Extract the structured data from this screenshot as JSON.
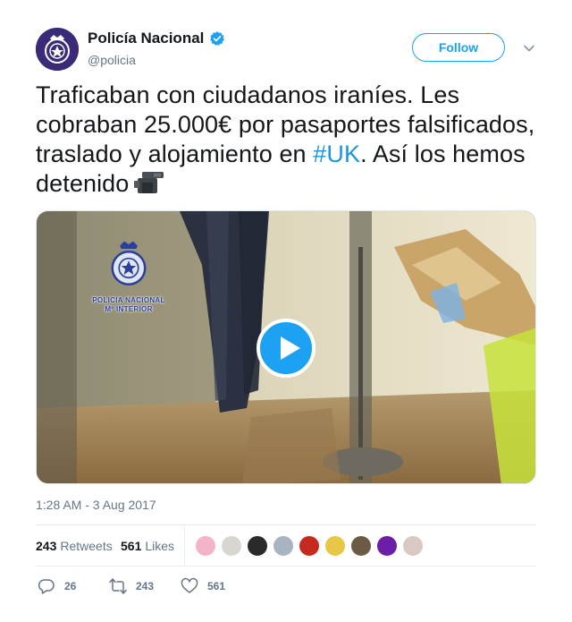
{
  "account": {
    "name": "Policía Nacional",
    "handle": "@policia",
    "verified": true,
    "follow_label": "Follow"
  },
  "tweet": {
    "text_before": "Traficaban con ciudadanos iraníes. Les cobraban 25.000€ por pasaportes falsificados, traslado y alojamiento en ",
    "hashtag": "#UK",
    "text_after": ". Así los hemos detenido",
    "emoji_icon": "video-camera-icon"
  },
  "media": {
    "type": "video",
    "watermark_line1": "POLICIA NACIONAL",
    "watermark_line2": "Mº INTERIOR"
  },
  "timestamp": "1:28 AM - 3 Aug 2017",
  "stats": {
    "retweets_count": "243",
    "retweets_label": "Retweets",
    "likes_count": "561",
    "likes_label": "Likes"
  },
  "likers": [
    {
      "color": "#f3b3c8"
    },
    {
      "color": "#d8d6cf"
    },
    {
      "color": "#2a2a2a"
    },
    {
      "color": "#aab4c0"
    },
    {
      "color": "#c62a1e"
    },
    {
      "color": "#e8c646"
    },
    {
      "color": "#6b5a45"
    },
    {
      "color": "#6a1fa6"
    },
    {
      "color": "#d9c9c2"
    }
  ],
  "actions": {
    "reply_count": "26",
    "retweet_count": "243",
    "like_count": "561"
  },
  "colors": {
    "accent": "#1da1f2",
    "hashtag": "#1b95e0",
    "muted": "#657786"
  }
}
